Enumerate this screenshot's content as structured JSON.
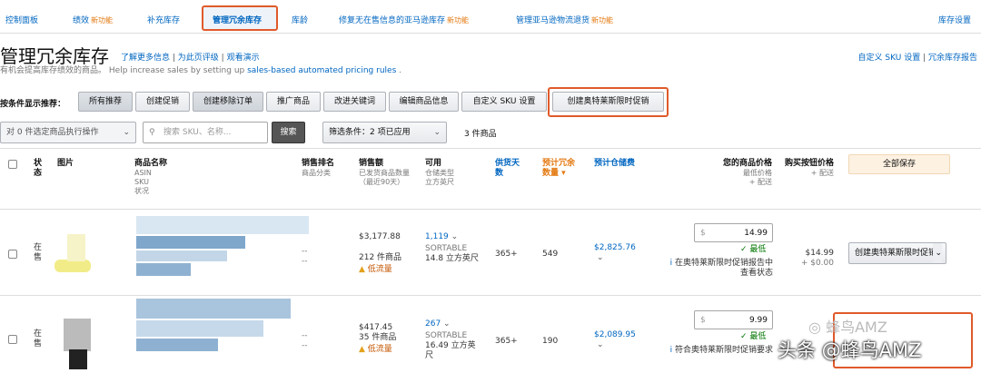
{
  "nav": {
    "items": [
      "控制面板",
      "绩效",
      "补充库存",
      "管理冗余库存",
      "库龄",
      "修复无在售信息的亚马逊库存",
      "管理亚马逊物流退货",
      "库存设置"
    ],
    "new_label": "新功能"
  },
  "header": {
    "title": "管理冗余库存",
    "learn_more": "了解更多信息",
    "rate_page": "为此页评级",
    "watch_demo": "观看演示",
    "subtitle_cn": "有机会提高库存绩效的商品。",
    "subtitle_en": "Help increase sales by setting up",
    "subtitle_link": "sales-based automated pricing rules",
    "custom_sku": "自定义 SKU 设置",
    "report": "冗余库存报告"
  },
  "reco": {
    "label": "按条件显示推荐：",
    "buttons": [
      "所有推荐",
      "创建促销",
      "创建移除订单",
      "推广商品",
      "改进关键词",
      "编辑商品信息",
      "自定义 SKU 设置",
      "创建奥特莱斯限时促销"
    ]
  },
  "toolbar": {
    "bulk_action": "对 0 件选定商品执行操作",
    "search_placeholder": "搜索 SKU、名称...",
    "search_button": "搜索",
    "filter": "筛选条件：2 项已应用",
    "count": "3 件商品"
  },
  "columns": {
    "status": "状态",
    "image": "图片",
    "name": "商品名称",
    "name_sub": [
      "ASIN",
      "SKU",
      "状况"
    ],
    "rank": "销售排名",
    "rank_sub": "商品分类",
    "sales": "销售额",
    "sales_sub": "已发货商品数量（最近90天）",
    "avail": "可用",
    "avail_sub": "仓储类型 立方英尺",
    "supply": "供货天数",
    "excess": "预计冗余数量",
    "storage_fee": "预计仓储费",
    "your_price": "您的商品价格",
    "your_price_sub": [
      "最低价格",
      "+ 配送"
    ],
    "buybox": "购买按钮价格",
    "buybox_sub": "+ 配送",
    "save_all": "全部保存"
  },
  "rows": [
    {
      "status": "在售",
      "rank": "--",
      "rank2": "--",
      "sales": "$3,177.88",
      "units": "212 件商品",
      "low_traffic": "低流量",
      "avail": "1,119",
      "type": "SORTABLE",
      "cuft": "14.8 立方英尺",
      "supply": "365+",
      "excess": "549",
      "fee": "$2,825.76",
      "price": "14.99",
      "price_status": "最低",
      "outlet_note": "在奥特莱斯限时促销报告中查看状态",
      "buybox": "$14.99",
      "buybox_ship": "+ $0.00",
      "action": "创建奥特莱斯限时促销"
    },
    {
      "status": "在售",
      "rank": "--",
      "rank2": "--",
      "sales": "$417.45",
      "units": "35 件商品",
      "low_traffic": "低流量",
      "avail": "267",
      "type": "SORTABLE",
      "cuft": "16.49 立方英尺",
      "supply": "365+",
      "excess": "190",
      "fee": "$2,089.95",
      "price": "9.99",
      "price_status": "最低",
      "outlet_note": "符合奥特莱斯限时促销要求"
    }
  ],
  "watermark": {
    "text": "头条 @蜂鸟AMZ",
    "text2": "蜂鸟AMZ"
  },
  "currency": "$",
  "colors": {
    "link": "#0066c0",
    "highlight": "#e05a2b",
    "new": "#e47911",
    "green": "#007600"
  }
}
